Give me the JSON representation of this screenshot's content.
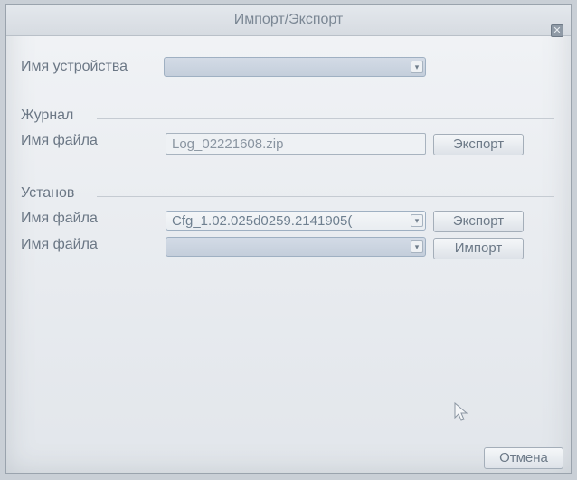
{
  "window": {
    "title": "Импорт/Экспорт",
    "close_glyph": "✕"
  },
  "device": {
    "label": "Имя устройства",
    "value": "",
    "arrow_glyph": "▾"
  },
  "log_section": {
    "label": "Журнал",
    "file_label": "Имя файла",
    "file_value": "Log_02221608.zip",
    "export_label": "Экспорт"
  },
  "settings_section": {
    "label": "Установ",
    "export_row": {
      "file_label": "Имя файла",
      "file_value": "Cfg_1.02.025d0259.2141905(",
      "button_label": "Экспорт"
    },
    "import_row": {
      "file_label": "Имя файла",
      "file_value": "",
      "button_label": "Импорт"
    }
  },
  "footer": {
    "cancel_label": "Отмена"
  },
  "icons": {
    "cursor": "mouse-pointer-icon"
  }
}
